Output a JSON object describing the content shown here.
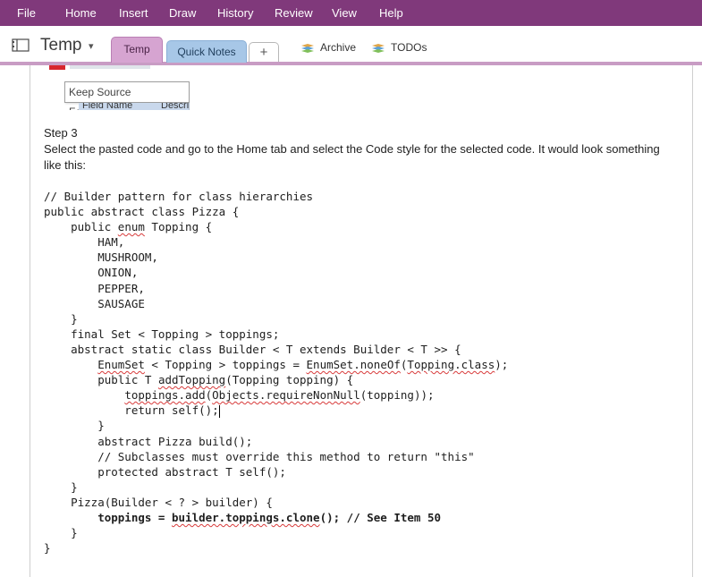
{
  "menu": [
    "File",
    "Home",
    "Insert",
    "Draw",
    "History",
    "Review",
    "View",
    "Help"
  ],
  "notebook": {
    "name": "Temp",
    "chevron": "▾"
  },
  "tabs": {
    "active": "Temp",
    "second": "Quick Notes",
    "add": "+"
  },
  "sections": [
    {
      "label": "Archive",
      "icon": "section-group-icon"
    },
    {
      "label": "TODOs",
      "icon": "section-group-icon"
    }
  ],
  "clipped": {
    "tooltip": "Keep Source Formatting (K)",
    "row_col1": "Field Name",
    "row_col2": "Descript"
  },
  "step": {
    "heading": "Step 3",
    "line1": "Select the pasted code and go to the Home tab and select the Code style for the selected code. It would look something",
    "line2": "like this:"
  },
  "code_lines": [
    {
      "parts": [
        {
          "t": "// Builder pattern for class hierarchies"
        }
      ]
    },
    {
      "parts": [
        {
          "t": "public abstract class Pizza {"
        }
      ]
    },
    {
      "parts": [
        {
          "t": "    public "
        },
        {
          "t": "enum",
          "sq": true
        },
        {
          "t": " Topping {"
        }
      ]
    },
    {
      "parts": [
        {
          "t": "        HAM,"
        }
      ]
    },
    {
      "parts": [
        {
          "t": "        MUSHROOM,"
        }
      ]
    },
    {
      "parts": [
        {
          "t": "        ONION,"
        }
      ]
    },
    {
      "parts": [
        {
          "t": "        PEPPER,"
        }
      ]
    },
    {
      "parts": [
        {
          "t": "        SAUSAGE"
        }
      ]
    },
    {
      "parts": [
        {
          "t": "    }"
        }
      ]
    },
    {
      "parts": [
        {
          "t": "    final Set < Topping > toppings;"
        }
      ]
    },
    {
      "parts": [
        {
          "t": "    abstract static class Builder < T extends Builder < T >> {"
        }
      ]
    },
    {
      "parts": [
        {
          "t": "        "
        },
        {
          "t": "EnumSet",
          "sq": true
        },
        {
          "t": " < Topping > toppings = "
        },
        {
          "t": "EnumSet.noneOf",
          "sq": true
        },
        {
          "t": "("
        },
        {
          "t": "Topping.class",
          "sq": true
        },
        {
          "t": ");"
        }
      ]
    },
    {
      "parts": [
        {
          "t": "        public T "
        },
        {
          "t": "addTopping",
          "sq": true
        },
        {
          "t": "(Topping topping) {"
        }
      ]
    },
    {
      "parts": [
        {
          "t": "            "
        },
        {
          "t": "toppings.add",
          "sq": true
        },
        {
          "t": "("
        },
        {
          "t": "Objects.requireNonNull",
          "sq": true
        },
        {
          "t": "(topping));"
        }
      ]
    },
    {
      "parts": [
        {
          "t": "            return self();"
        }
      ],
      "cursor": true
    },
    {
      "parts": [
        {
          "t": "        }"
        }
      ]
    },
    {
      "parts": [
        {
          "t": "        abstract Pizza build();"
        }
      ]
    },
    {
      "parts": [
        {
          "t": "        // Subclasses must override this method to return \"this\""
        }
      ]
    },
    {
      "parts": [
        {
          "t": "        protected abstract T self();"
        }
      ]
    },
    {
      "parts": [
        {
          "t": "    }"
        }
      ]
    },
    {
      "parts": [
        {
          "t": "    Pizza(Builder < ? > builder) {"
        }
      ]
    },
    {
      "bold": true,
      "parts": [
        {
          "t": "        toppings = "
        },
        {
          "t": "builder.toppings.clone",
          "sq": true
        },
        {
          "t": "(); // See Item 50"
        }
      ]
    },
    {
      "parts": [
        {
          "t": "    }"
        }
      ]
    },
    {
      "parts": [
        {
          "t": "}"
        }
      ]
    }
  ],
  "colors": {
    "menubar": "#80397b",
    "tab_active": "#d6a4d1",
    "tab_quick": "#a7c7e7",
    "tab_underline": "#c89cc4"
  }
}
